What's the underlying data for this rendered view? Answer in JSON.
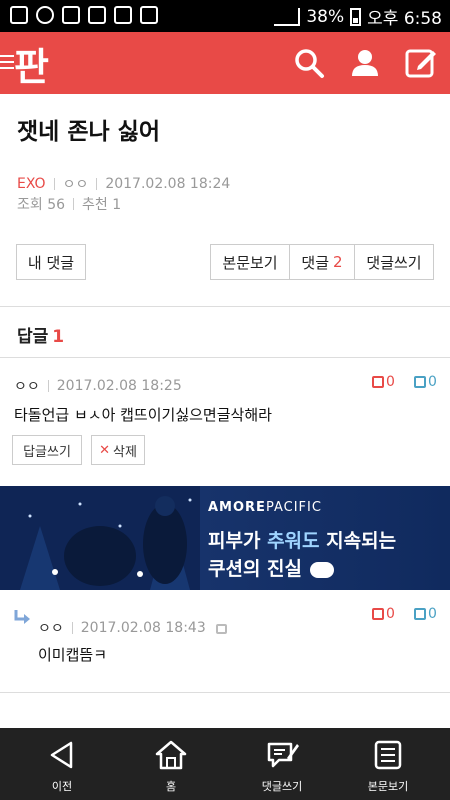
{
  "status_bar": {
    "battery": "38%",
    "time": "오후 6:58"
  },
  "app": {
    "logo": "판",
    "brand_color": "#e84a47"
  },
  "post": {
    "title": "잿네 존나 싫어",
    "category": "EXO",
    "author": "ㅇㅇ",
    "date": "2017.02.08 18:24",
    "views": "조회 56",
    "recommend": "추천 1"
  },
  "actions": {
    "my_comment": "내 댓글",
    "view_post": "본문보기",
    "comment_label": "댓글",
    "comment_count": "2",
    "write_comment": "댓글쓰기"
  },
  "replies": {
    "heading": "답글",
    "count": "1",
    "items": [
      {
        "author": "ㅇㅇ",
        "date": "2017.02.08 18:25",
        "text": "타돌언급 ㅂㅅ아 캡뜨이기싫으면글삭해라",
        "up": "0",
        "down": "0",
        "reply_button": "답글쓰기",
        "delete_button": "삭제"
      },
      {
        "author": "ㅇㅇ",
        "date": "2017.02.08 18:43",
        "text": "이미캡뜸ㅋ",
        "up": "0",
        "down": "0"
      }
    ]
  },
  "ad": {
    "brand_bold": "AMORE",
    "brand_light": "PACIFIC",
    "line1_a": "피부가 ",
    "line1_b": "추워도",
    "line1_c": " 지속되는",
    "line2": "쿠션의 진실"
  },
  "bottom_nav": {
    "items": [
      {
        "label": "이전",
        "icon": "back-triangle-icon"
      },
      {
        "label": "홈",
        "icon": "home-icon"
      },
      {
        "label": "댓글쓰기",
        "icon": "comment-write-icon"
      },
      {
        "label": "본문보기",
        "icon": "document-icon"
      }
    ]
  }
}
